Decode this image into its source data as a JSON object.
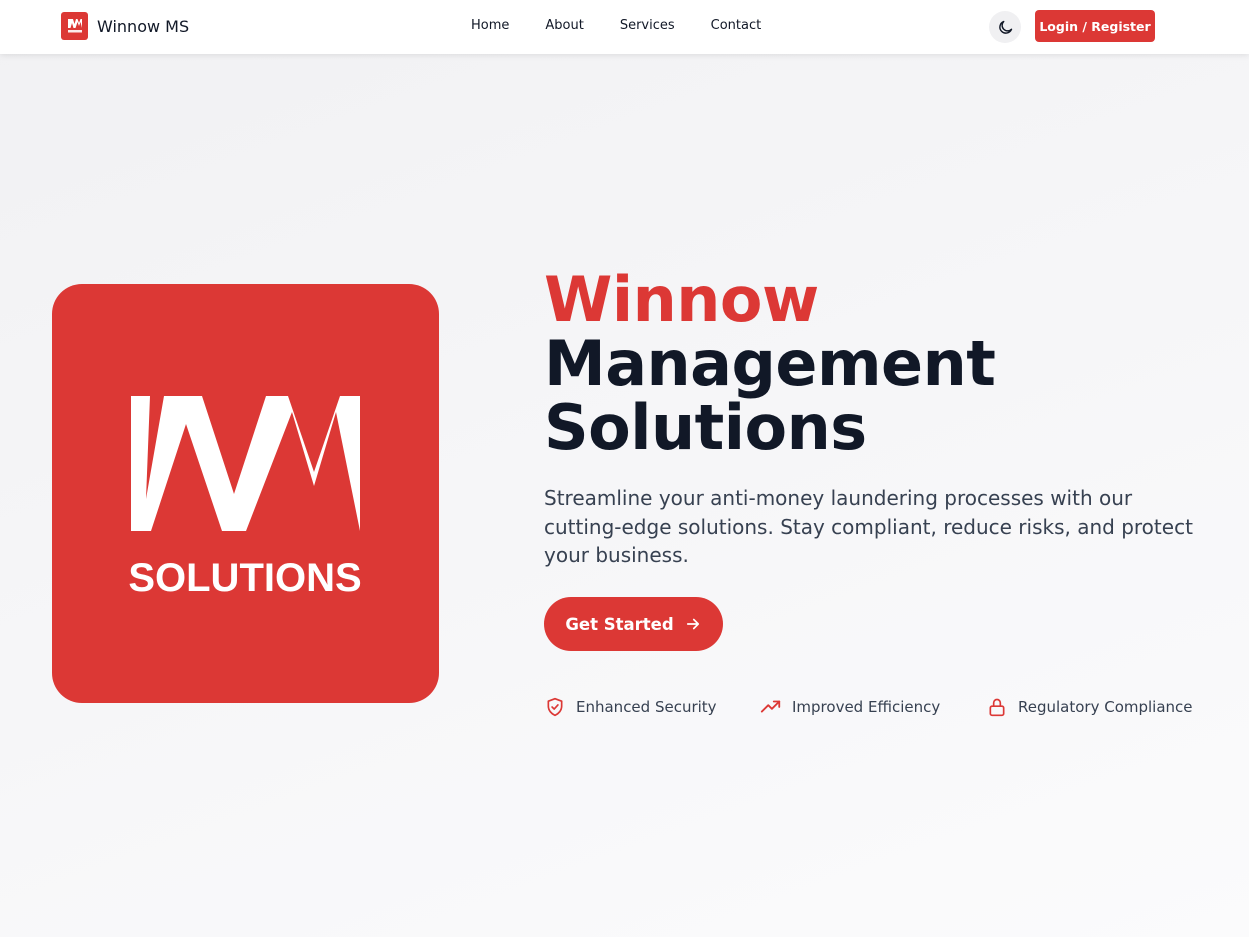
{
  "header": {
    "brand_name": "Winnow MS",
    "brand_logo_text": "WM",
    "nav": [
      "Home",
      "About",
      "Services",
      "Contact"
    ],
    "theme_toggle_icon": "moon-icon",
    "login_label": "Login / Register"
  },
  "hero": {
    "logo_text": "WM",
    "logo_subtext": "SOLUTIONS",
    "title_line1": "Winnow",
    "title_line2": "Management",
    "title_line3": "Solutions",
    "description": "Streamline your anti-money laundering processes with our cutting-edge solutions. Stay compliant, reduce risks, and protect your business.",
    "cta_label": "Get Started",
    "cta_icon": "arrow-right-icon",
    "features": [
      {
        "label": "Enhanced Security",
        "icon": "shield-check-icon"
      },
      {
        "label": "Improved Efficiency",
        "icon": "trending-up-icon"
      },
      {
        "label": "Regulatory Compliance",
        "icon": "lock-icon"
      }
    ]
  },
  "colors": {
    "accent": "#dc3835",
    "text_dark": "#111827",
    "text_muted": "#374151"
  }
}
